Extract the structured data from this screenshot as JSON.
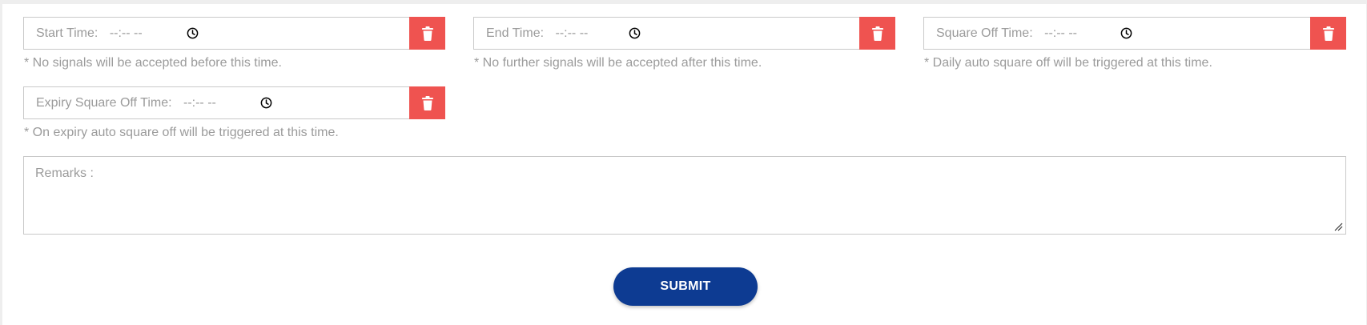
{
  "fields": {
    "start_time": {
      "label": "Start Time:",
      "value": "--:-- --",
      "hint": "* No signals will be accepted before this time."
    },
    "end_time": {
      "label": "End Time:",
      "value": "--:-- --",
      "hint": "* No further signals will be accepted after this time."
    },
    "square_off_time": {
      "label": "Square Off Time:",
      "value": "--:-- --",
      "hint": "* Daily auto square off will be triggered at this time."
    },
    "expiry_square_off_time": {
      "label": "Expiry Square Off Time:",
      "value": "--:-- --",
      "hint": "* On expiry auto square off will be triggered at this time."
    }
  },
  "remarks": {
    "placeholder": "Remarks :"
  },
  "submit": {
    "label": "SUBMIT"
  },
  "icons": {
    "time": "clock-icon",
    "delete": "trash-icon",
    "resize": "resize-handle-icon"
  },
  "colors": {
    "delete_button": "#ef5350",
    "submit_button": "#0d3b92",
    "border": "#c9c9c9",
    "muted_text": "#9b9b9b"
  }
}
